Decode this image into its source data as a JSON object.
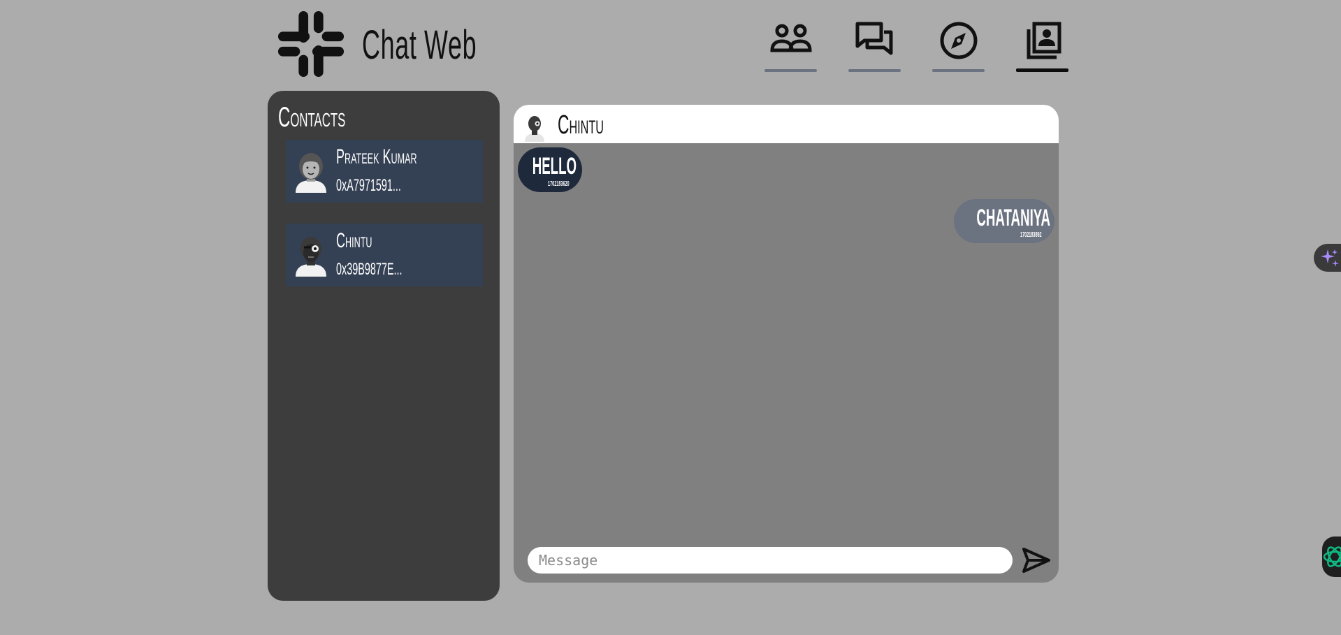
{
  "app": {
    "title": "Chat Web"
  },
  "nav": [
    {
      "name": "friends",
      "icon": "people-icon",
      "active": false
    },
    {
      "name": "chats",
      "icon": "chat-bubbles-icon",
      "active": false
    },
    {
      "name": "explore",
      "icon": "compass-icon",
      "active": false
    },
    {
      "name": "contacts",
      "icon": "contact-card-icon",
      "active": true
    }
  ],
  "contacts": {
    "title": "Contacts",
    "items": [
      {
        "name": "Prateek Kumar",
        "address": "0xA7971591..."
      },
      {
        "name": "Chintu",
        "address": "0x39B9877E..."
      }
    ]
  },
  "chat": {
    "contact_name": "Chintu",
    "messages": [
      {
        "direction": "incoming",
        "text": "HELLO",
        "timestamp": "1702183620"
      },
      {
        "direction": "outgoing",
        "text": "CHATANIYA",
        "timestamp": "1702183892"
      }
    ],
    "input": {
      "placeholder": "Message",
      "value": ""
    }
  },
  "colors": {
    "background": "#acacac",
    "panel_dark": "#3d3d3d",
    "contact_card": "#344054",
    "chat_bg": "#808080",
    "incoming_bubble": "#1e293b",
    "outgoing_bubble": "#6b7280"
  }
}
